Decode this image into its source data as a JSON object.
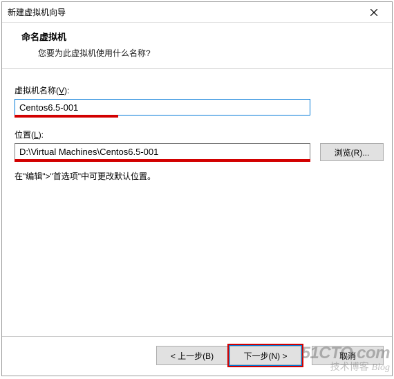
{
  "window": {
    "title": "新建虚拟机向导"
  },
  "header": {
    "heading": "命名虚拟机",
    "subheading": "您要为此虚拟机使用什么名称?"
  },
  "fields": {
    "vmname": {
      "label_prefix": "虚拟机名称(",
      "label_key": "V",
      "label_suffix": "):",
      "value": "Centos6.5-001"
    },
    "location": {
      "label_prefix": "位置(",
      "label_key": "L",
      "label_suffix": "):",
      "value": "D:\\Virtual Machines\\Centos6.5-001",
      "browse_label": "浏览(R)..."
    },
    "hint": "在\"编辑\">\"首选项\"中可更改默认位置。"
  },
  "footer": {
    "back": "< 上一步(B)",
    "next": "下一步(N) >",
    "cancel": "取消"
  },
  "watermark": {
    "line1": "51CTO.com",
    "line2_cn": "技术博客",
    "line2_en": "Blog"
  },
  "colors": {
    "highlight_red": "#d20000",
    "focus_blue": "#0078d7"
  }
}
